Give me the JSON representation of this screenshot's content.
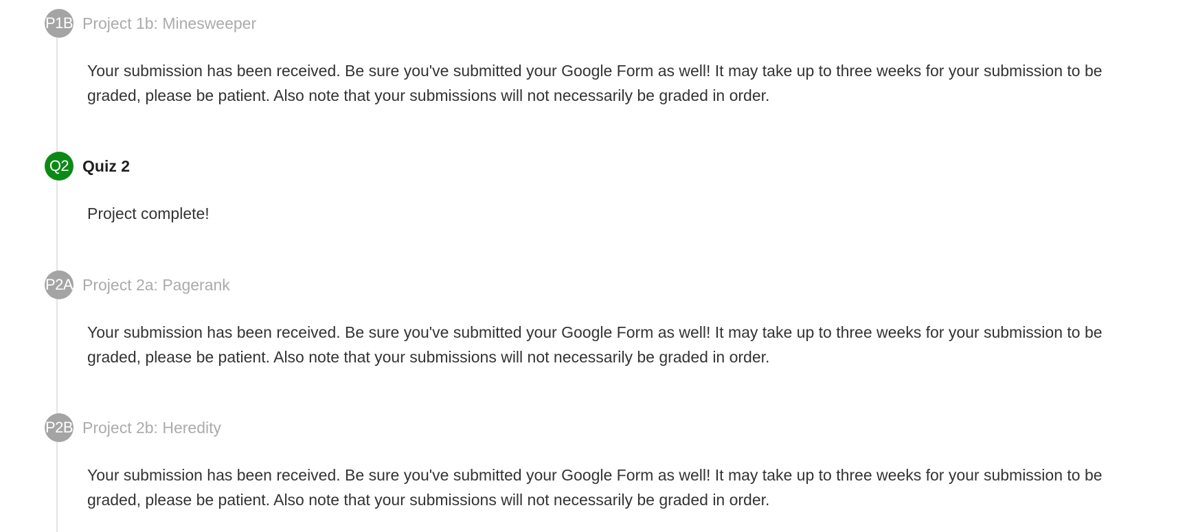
{
  "timeline": {
    "items": [
      {
        "badge": "P1B",
        "title": "Project 1b: Minesweeper",
        "status": "pending",
        "message": "Your submission has been received. Be sure you've submitted your Google Form as well! It may take up to three weeks for your submission to be graded, please be patient. Also note that your submissions will not necessarily be graded in order."
      },
      {
        "badge": "Q2",
        "title": "Quiz 2",
        "status": "complete",
        "message": "Project complete!"
      },
      {
        "badge": "P2A",
        "title": "Project 2a: Pagerank",
        "status": "pending",
        "message": "Your submission has been received. Be sure you've submitted your Google Form as well! It may take up to three weeks for your submission to be graded, please be patient. Also note that your submissions will not necessarily be graded in order."
      },
      {
        "badge": "P2B",
        "title": "Project 2b: Heredity",
        "status": "pending",
        "message": "Your submission has been received. Be sure you've submitted your Google Form as well! It may take up to three weeks for your submission to be graded, please be patient. Also note that your submissions will not necessarily be graded in order."
      }
    ]
  },
  "colors": {
    "pending_badge": "#a4a4a4",
    "complete_badge": "#0c8a16",
    "rail": "#e3e3e3",
    "text": "#333333"
  }
}
